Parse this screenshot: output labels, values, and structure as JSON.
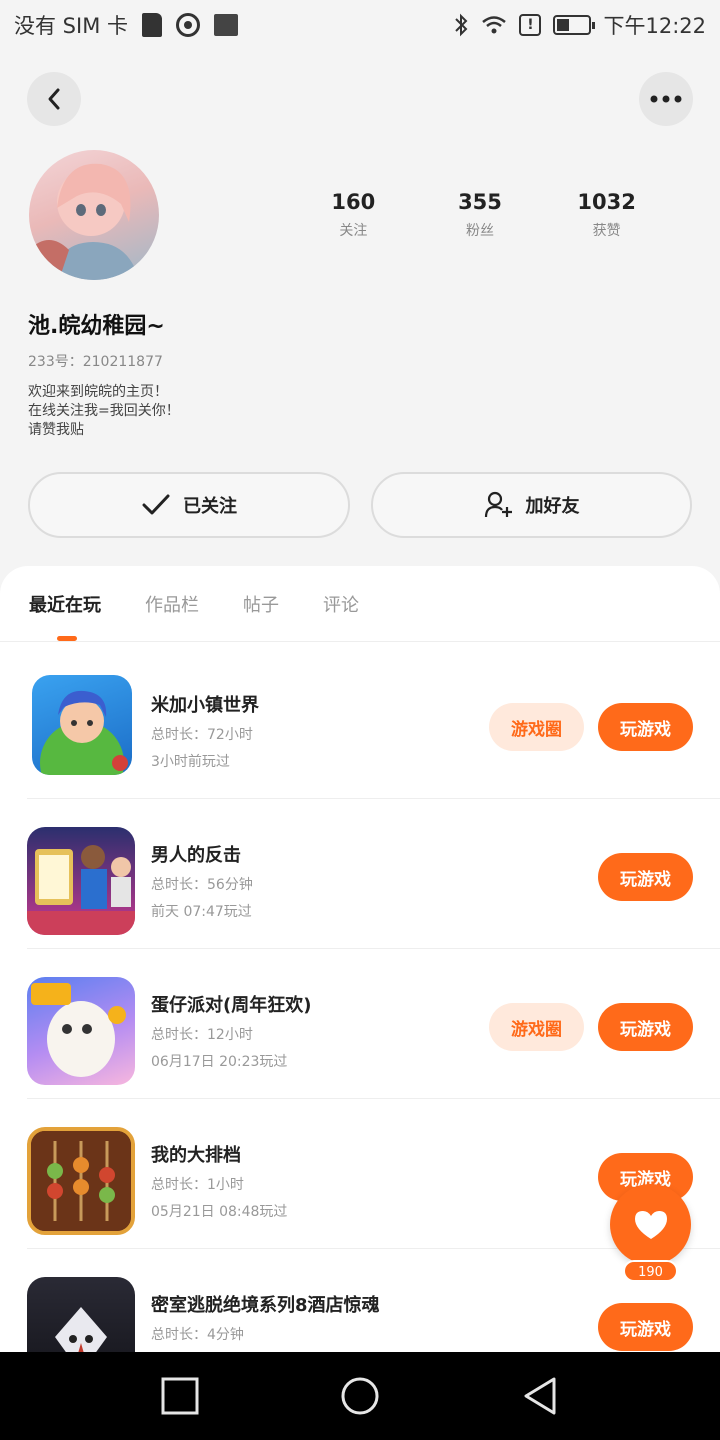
{
  "status_bar": {
    "carrier": "没有 SIM 卡",
    "time": "下午12:22",
    "icons": [
      "sim-card-icon",
      "camera-icon",
      "image-icon",
      "bluetooth-icon",
      "wifi-icon",
      "alert-icon",
      "battery-icon"
    ]
  },
  "header": {
    "back_icon": "chevron-left-icon",
    "more_icon": "more-dots-icon"
  },
  "profile": {
    "username": "池.皖幼稚园~",
    "uid": "233号：210211877",
    "bio": [
      "欢迎来到皖皖的主页！",
      "在线关注我=我回关你！",
      "请赞我贴"
    ],
    "stats": [
      {
        "value": "160",
        "label": "关注"
      },
      {
        "value": "355",
        "label": "粉丝"
      },
      {
        "value": "1032",
        "label": "获赞"
      }
    ]
  },
  "actions": {
    "follow_label": "已关注",
    "add_friend_label": "加好友"
  },
  "tabs": [
    "最近在玩",
    "作品栏",
    "帖子",
    "评论"
  ],
  "active_tab": "最近在玩",
  "games": [
    {
      "name": "米加小镇世界",
      "duration": "总时长：72小时",
      "last_played": "3小时前玩过",
      "circle_label": "游戏圈",
      "play_label": "玩游戏"
    },
    {
      "name": "男人的反击",
      "duration": "总时长：56分钟",
      "last_played": "前天 07:47玩过",
      "circle_label": "",
      "play_label": "玩游戏"
    },
    {
      "name": "蛋仔派对(周年狂欢)",
      "duration": "总时长：12小时",
      "last_played": "06月17日 20:23玩过",
      "circle_label": "游戏圈",
      "play_label": "玩游戏"
    },
    {
      "name": "我的大排档",
      "duration": "总时长：1小时",
      "last_played": "05月21日 08:48玩过",
      "circle_label": "",
      "play_label": "玩游戏"
    },
    {
      "name": "密室逃脱绝境系列8酒店惊魂",
      "duration": "总时长：4分钟",
      "last_played": "",
      "circle_label": "",
      "play_label": "玩游戏"
    }
  ],
  "float_like": {
    "count": "190"
  },
  "colors": {
    "accent": "#ff6a1a",
    "accent_light": "#ffe9dc",
    "background": "#f4f4f4"
  }
}
